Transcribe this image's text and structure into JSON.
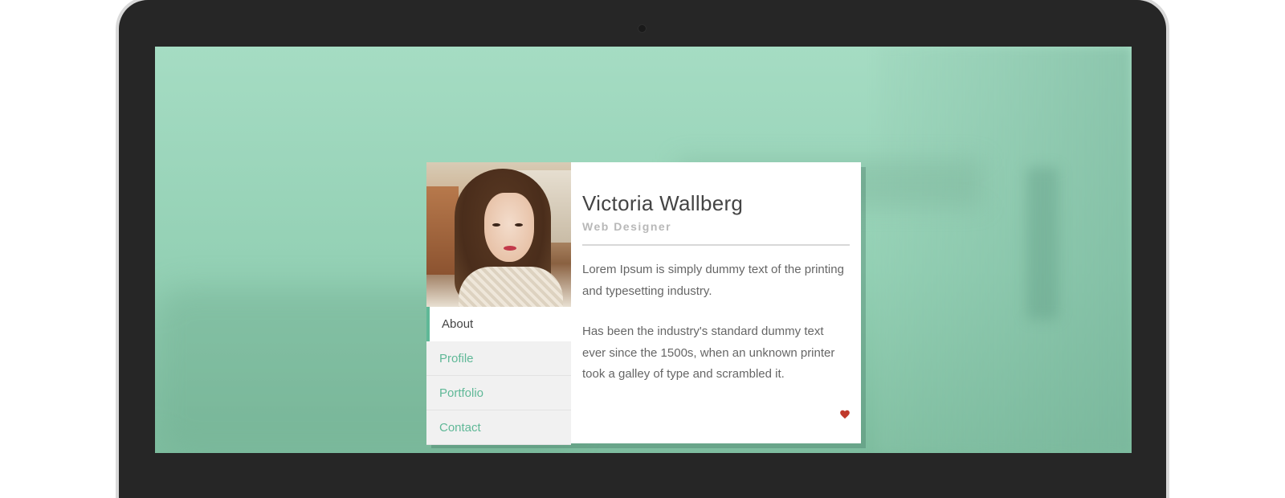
{
  "profile": {
    "name": "Victoria Wallberg",
    "role": "Web Designer",
    "paragraphs": [
      "Lorem Ipsum is simply dummy text of the printing and typesetting industry.",
      "Has been the industry's standard dummy text ever since the 1500s, when an unknown printer took a galley of type and scrambled it."
    ]
  },
  "menu": {
    "items": [
      {
        "label": "About",
        "active": true
      },
      {
        "label": "Profile",
        "active": false
      },
      {
        "label": "Portfolio",
        "active": false
      },
      {
        "label": "Contact",
        "active": false
      }
    ]
  },
  "icons": {
    "like": "heart-icon"
  },
  "colors": {
    "accent": "#5fb897",
    "heart": "#c0392b",
    "background_tint": "#9ad6bb",
    "laptop_bezel": "#262626"
  }
}
